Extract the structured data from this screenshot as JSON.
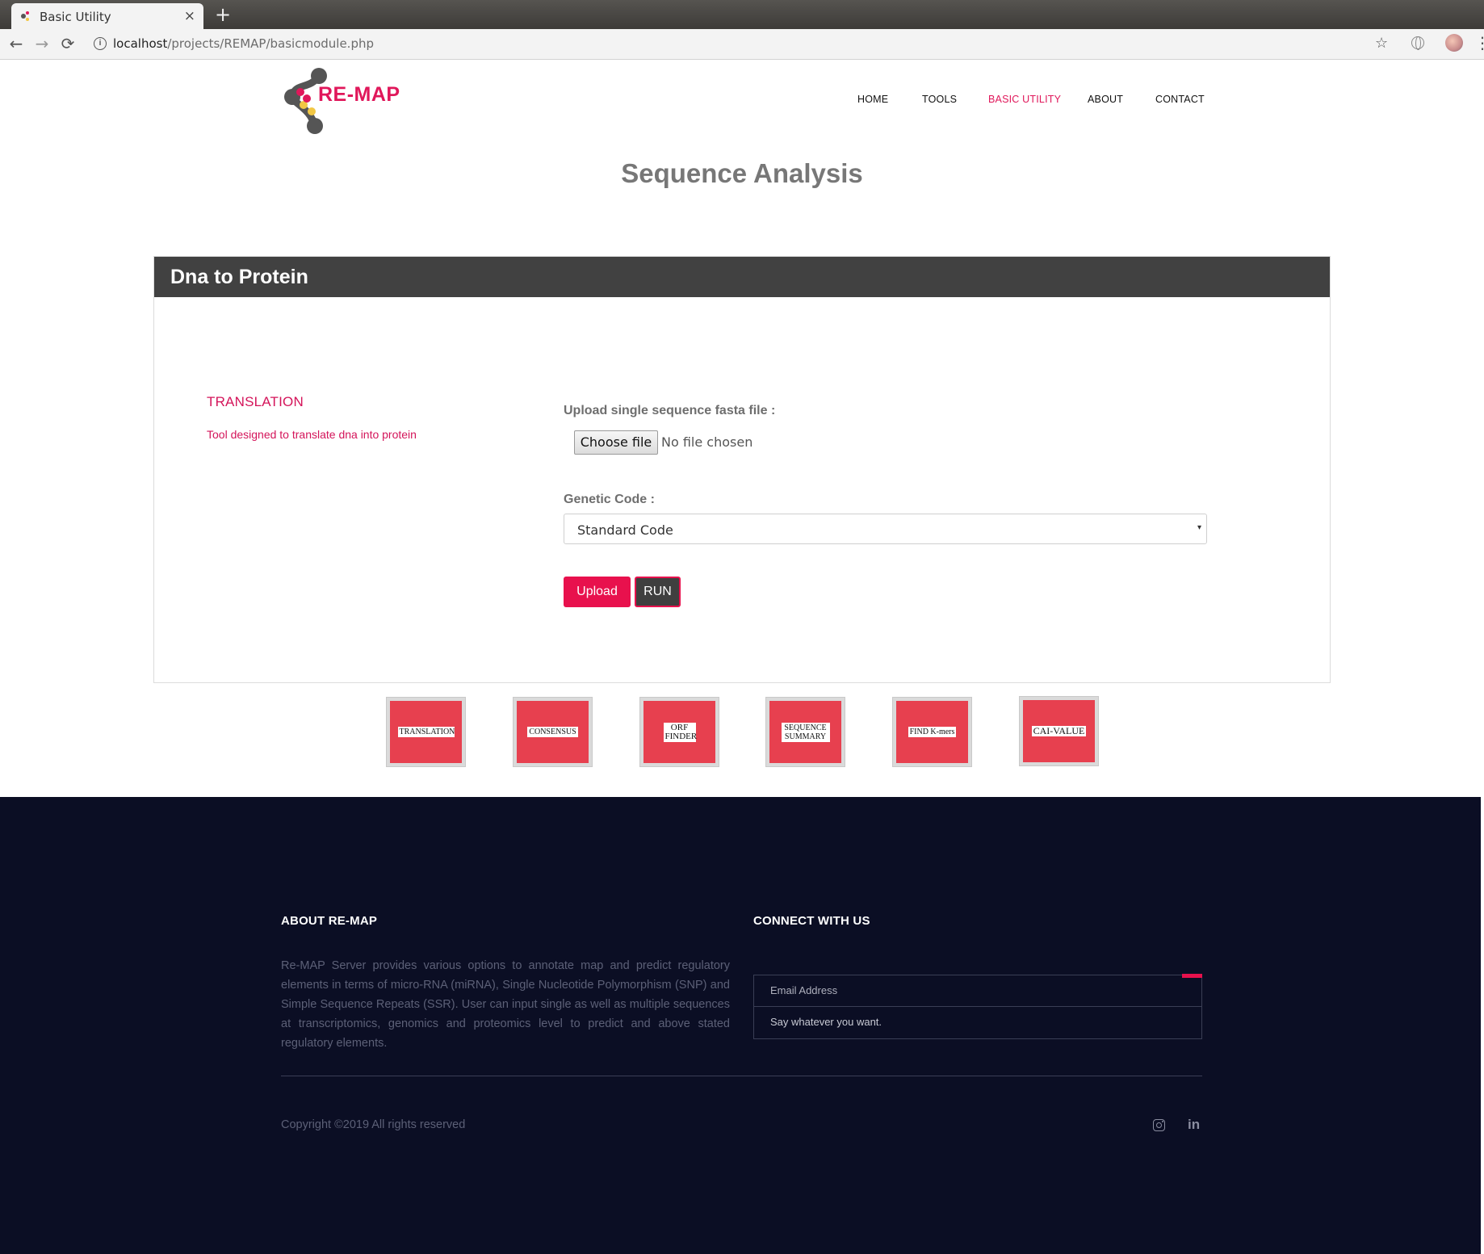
{
  "browser": {
    "tab_title": "Basic Utility",
    "tab_close": "×",
    "new_tab": "+",
    "url_host": "localhost",
    "url_path": "/projects/REMAP/basicmodule.php",
    "back_icon": "←",
    "forward_icon": "→",
    "reload_icon": "⟳",
    "info_icon": "i",
    "bookmark_icon": "☆",
    "menu_icon": "⋮"
  },
  "site": {
    "logo_text": "RE-MAP",
    "nav": [
      "HOME",
      "TOOLS",
      "BASIC UTILITY",
      "ABOUT",
      "CONTACT"
    ],
    "nav_active": "BASIC UTILITY",
    "page_title": "Sequence Analysis",
    "accent_color": "#e0175a"
  },
  "card": {
    "header": "Dna to Protein",
    "tool_title": "TRANSLATION",
    "tool_desc": "Tool designed to translate dna into protein",
    "upload_label": "Upload single sequence fasta file :",
    "choose_file": "Choose file",
    "no_file": "No file chosen",
    "genetic_code_label": "Genetic Code :",
    "genetic_code_value": "Standard Code",
    "select_caret": "▾",
    "upload_button": "Upload",
    "run_button": "RUN"
  },
  "tiles": [
    {
      "label": "TRANSLATION"
    },
    {
      "label": "CONSENSUS"
    },
    {
      "label": "ORF FINDER"
    },
    {
      "label": "SEQUENCE SUMMARY"
    },
    {
      "label": "FIND K-mers"
    },
    {
      "label": "CAI-VALUE"
    }
  ],
  "footer": {
    "about_heading": "ABOUT RE-MAP",
    "about_text": "Re-MAP Server provides various options to annotate map and predict regulatory elements in terms of micro-RNA (miRNA), Single Nucleotide Polymorphism (SNP) and Simple Sequence Repeats (SSR). User can input single as well as multiple sequences at transcriptomics, genomics and proteomics level to predict and above stated regulatory elements.",
    "connect_heading": "CONNECT WITH US",
    "email_placeholder": "Email Address",
    "message_placeholder": "Say whatever you want.",
    "copyright": "Copyright ©2019 All rights reserved",
    "linkedin_label": "in",
    "background_color": "#0b0e24"
  }
}
